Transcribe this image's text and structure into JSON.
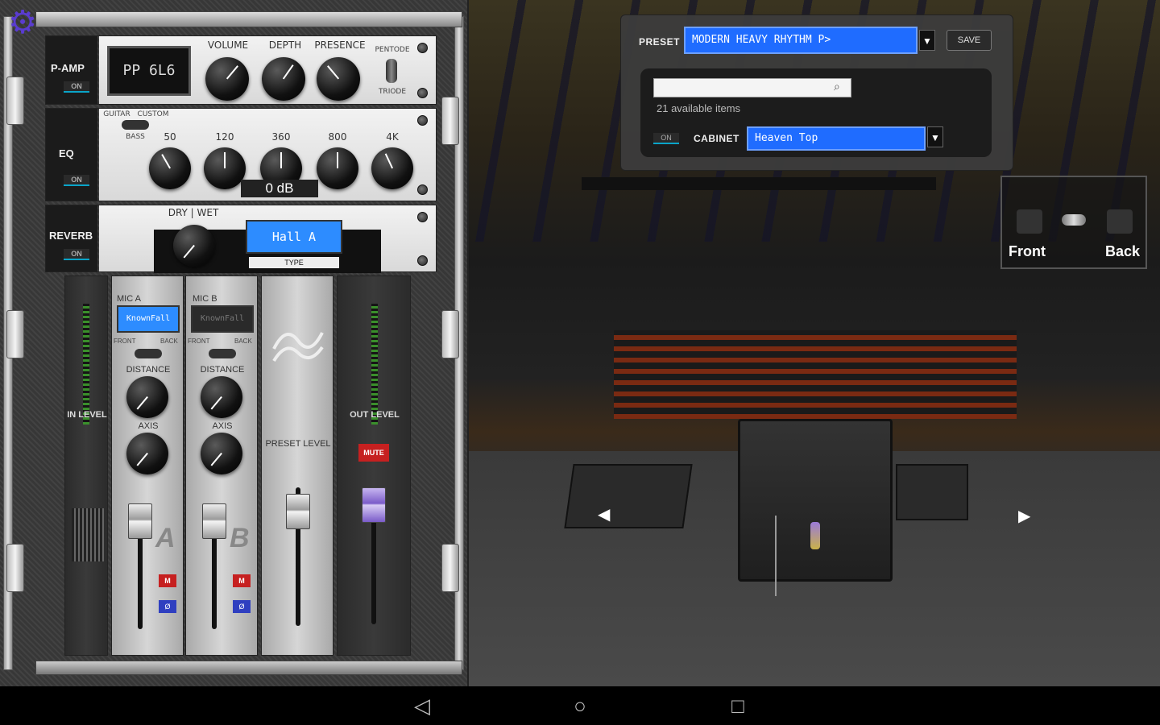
{
  "rack": {
    "preamp": {
      "label": "P-AMP",
      "on_label": "ON",
      "display": "PP 6L6",
      "knobs": [
        "VOLUME",
        "DEPTH",
        "PRESENCE"
      ],
      "switch_top": "PENTODE",
      "switch_bottom": "TRIODE"
    },
    "eq": {
      "label": "EQ",
      "on_label": "ON",
      "mode_left": "GUITAR",
      "mode_right": "CUSTOM",
      "mode_sub": "BASS",
      "bands": [
        "50",
        "120",
        "360",
        "800",
        "4K"
      ],
      "gain_readout": "0 dB"
    },
    "reverb": {
      "label": "REVERB",
      "on_label": "ON",
      "mix_label": "DRY | WET",
      "type_value": "Hall A",
      "type_label": "TYPE"
    },
    "in_level_label": "IN LEVEL",
    "mic_a": {
      "title": "MIC A",
      "model": "KnownFall",
      "front": "FRONT",
      "back": "BACK",
      "distance": "DISTANCE",
      "axis": "AXIS",
      "letter": "A",
      "m_btn": "M",
      "s_btn": "Ø"
    },
    "mic_b": {
      "title": "MIC B",
      "model": "KnownFall",
      "front": "FRONT",
      "back": "BACK",
      "distance": "DISTANCE",
      "axis": "AXIS",
      "letter": "B",
      "m_btn": "M",
      "s_btn": "Ø"
    },
    "preset_level_label": "PRESET LEVEL",
    "out_level_label": "OUT LEVEL",
    "mute_label": "MUTE"
  },
  "preset_panel": {
    "preset_label": "PRESET",
    "preset_value": "MODERN HEAVY RHYTHM P>",
    "save_label": "SAVE",
    "search_placeholder": "",
    "available_text": "21 available items",
    "cabinet_on": "ON",
    "cabinet_label": "CABINET",
    "cabinet_value": "Heaven Top"
  },
  "view_panel": {
    "front_label": "Front",
    "back_label": "Back"
  },
  "colors": {
    "lcd_blue": "#2d8cff",
    "accent_cyan": "#0aa4c8",
    "mute_red": "#c62020",
    "gear_purple": "#5a3cd0"
  }
}
